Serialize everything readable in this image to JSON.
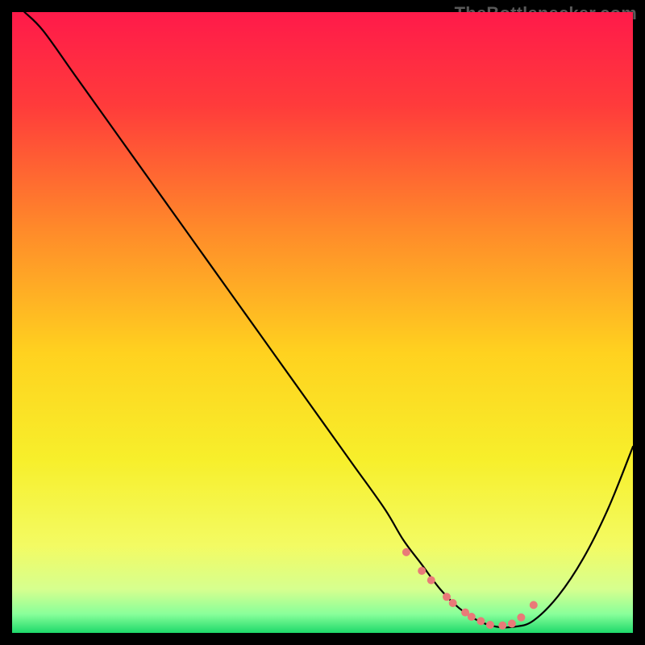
{
  "watermark": {
    "text": "TheBottlenecker.com"
  },
  "chart_data": {
    "type": "line",
    "title": "",
    "xlabel": "",
    "ylabel": "",
    "xlim": [
      0,
      100
    ],
    "ylim": [
      0,
      100
    ],
    "grid": false,
    "background": {
      "type": "vertical-gradient",
      "stops": [
        {
          "pos": 0.0,
          "color": "#ff1a4a"
        },
        {
          "pos": 0.15,
          "color": "#ff3b3b"
        },
        {
          "pos": 0.35,
          "color": "#ff8a2a"
        },
        {
          "pos": 0.55,
          "color": "#ffd21f"
        },
        {
          "pos": 0.72,
          "color": "#f7ef2b"
        },
        {
          "pos": 0.86,
          "color": "#f3fb63"
        },
        {
          "pos": 0.93,
          "color": "#d6ff8f"
        },
        {
          "pos": 0.97,
          "color": "#88ff9a"
        },
        {
          "pos": 1.0,
          "color": "#1ed96b"
        }
      ]
    },
    "series": [
      {
        "name": "bottleneck-curve",
        "color": "#000000",
        "x": [
          2,
          5,
          10,
          15,
          20,
          25,
          30,
          35,
          40,
          45,
          50,
          55,
          60,
          63,
          66,
          69,
          72,
          75,
          78,
          81,
          84,
          88,
          92,
          96,
          100
        ],
        "y": [
          100,
          97,
          90,
          83,
          76,
          69,
          62,
          55,
          48,
          41,
          34,
          27,
          20,
          15,
          11,
          7,
          4,
          2,
          1,
          1,
          2,
          6,
          12,
          20,
          30
        ]
      }
    ],
    "markers": {
      "name": "optimal-range",
      "color": "#e97a78",
      "radius": 5,
      "x": [
        63.5,
        66.0,
        67.5,
        70.0,
        71.0,
        73.0,
        74.0,
        75.5,
        77.0,
        79.0,
        80.5,
        82.0,
        84.0
      ],
      "y": [
        13.0,
        10.0,
        8.5,
        5.8,
        4.8,
        3.3,
        2.6,
        1.9,
        1.3,
        1.2,
        1.5,
        2.5,
        4.5
      ]
    }
  }
}
